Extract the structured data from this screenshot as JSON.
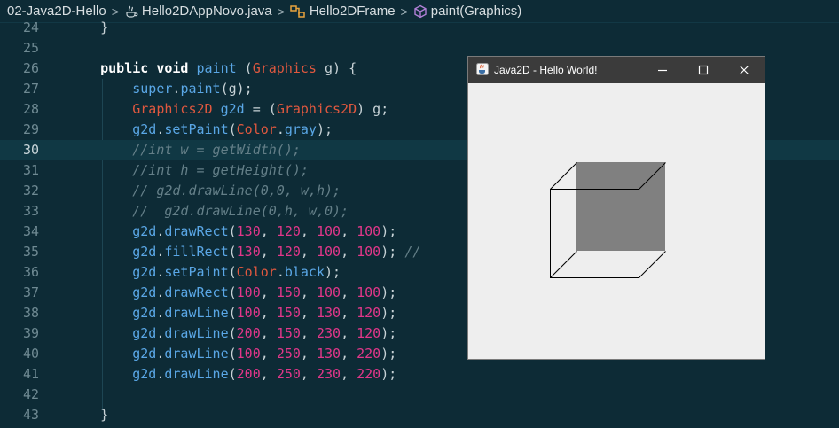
{
  "breadcrumb": {
    "items": [
      {
        "label": "02-Java2D-Hello",
        "icon": null
      },
      {
        "label": "Hello2DAppNovo.java",
        "icon": "java-file-icon"
      },
      {
        "label": "Hello2DFrame",
        "icon": "class-icon"
      },
      {
        "label": "paint(Graphics)",
        "icon": "method-cube-icon"
      }
    ],
    "separator": ">"
  },
  "editor": {
    "current_line": 30,
    "lines": [
      {
        "n": "24",
        "tokens": [
          [
            "op",
            "    }"
          ]
        ]
      },
      {
        "n": "25",
        "tokens": []
      },
      {
        "n": "26",
        "tokens": [
          [
            "op",
            "    "
          ],
          [
            "kw",
            "public"
          ],
          [
            "op",
            " "
          ],
          [
            "kw",
            "void"
          ],
          [
            "op",
            " "
          ],
          [
            "fn",
            "paint"
          ],
          [
            "op",
            " ("
          ],
          [
            "ty",
            "Graphics"
          ],
          [
            "op",
            " g) {"
          ]
        ]
      },
      {
        "n": "27",
        "tokens": [
          [
            "op",
            "        "
          ],
          [
            "id",
            "super"
          ],
          [
            "op",
            "."
          ],
          [
            "fn",
            "paint"
          ],
          [
            "op",
            "(g);"
          ]
        ]
      },
      {
        "n": "28",
        "tokens": [
          [
            "op",
            "        "
          ],
          [
            "ty",
            "Graphics2D"
          ],
          [
            "op",
            " "
          ],
          [
            "id",
            "g2d"
          ],
          [
            "op",
            " = ("
          ],
          [
            "ty",
            "Graphics2D"
          ],
          [
            "op",
            ") g;"
          ]
        ]
      },
      {
        "n": "29",
        "tokens": [
          [
            "op",
            "        "
          ],
          [
            "id",
            "g2d"
          ],
          [
            "op",
            "."
          ],
          [
            "fn",
            "setPaint"
          ],
          [
            "op",
            "("
          ],
          [
            "ty",
            "Color"
          ],
          [
            "op",
            "."
          ],
          [
            "id",
            "gray"
          ],
          [
            "op",
            ");"
          ]
        ]
      },
      {
        "n": "30",
        "tokens": [
          [
            "op",
            "        "
          ],
          [
            "cm",
            "//int w = getWidth();"
          ]
        ]
      },
      {
        "n": "31",
        "tokens": [
          [
            "op",
            "        "
          ],
          [
            "cm",
            "//int h = getHeight();"
          ]
        ]
      },
      {
        "n": "32",
        "tokens": [
          [
            "op",
            "        "
          ],
          [
            "cm",
            "// g2d.drawLine(0,0, w,h);"
          ]
        ]
      },
      {
        "n": "33",
        "tokens": [
          [
            "op",
            "        "
          ],
          [
            "cm",
            "//  g2d.drawLine(0,h, w,0);"
          ]
        ]
      },
      {
        "n": "34",
        "tokens": [
          [
            "op",
            "        "
          ],
          [
            "id",
            "g2d"
          ],
          [
            "op",
            "."
          ],
          [
            "fn",
            "drawRect"
          ],
          [
            "op",
            "("
          ],
          [
            "num",
            "130"
          ],
          [
            "op",
            ", "
          ],
          [
            "num",
            "120"
          ],
          [
            "op",
            ", "
          ],
          [
            "num",
            "100"
          ],
          [
            "op",
            ", "
          ],
          [
            "num",
            "100"
          ],
          [
            "op",
            ");"
          ]
        ]
      },
      {
        "n": "35",
        "tokens": [
          [
            "op",
            "        "
          ],
          [
            "id",
            "g2d"
          ],
          [
            "op",
            "."
          ],
          [
            "fn",
            "fillRect"
          ],
          [
            "op",
            "("
          ],
          [
            "num",
            "130"
          ],
          [
            "op",
            ", "
          ],
          [
            "num",
            "120"
          ],
          [
            "op",
            ", "
          ],
          [
            "num",
            "100"
          ],
          [
            "op",
            ", "
          ],
          [
            "num",
            "100"
          ],
          [
            "op",
            "); "
          ],
          [
            "cm",
            "//"
          ]
        ]
      },
      {
        "n": "36",
        "tokens": [
          [
            "op",
            "        "
          ],
          [
            "id",
            "g2d"
          ],
          [
            "op",
            "."
          ],
          [
            "fn",
            "setPaint"
          ],
          [
            "op",
            "("
          ],
          [
            "ty",
            "Color"
          ],
          [
            "op",
            "."
          ],
          [
            "id",
            "black"
          ],
          [
            "op",
            ");"
          ]
        ]
      },
      {
        "n": "37",
        "tokens": [
          [
            "op",
            "        "
          ],
          [
            "id",
            "g2d"
          ],
          [
            "op",
            "."
          ],
          [
            "fn",
            "drawRect"
          ],
          [
            "op",
            "("
          ],
          [
            "num",
            "100"
          ],
          [
            "op",
            ", "
          ],
          [
            "num",
            "150"
          ],
          [
            "op",
            ", "
          ],
          [
            "num",
            "100"
          ],
          [
            "op",
            ", "
          ],
          [
            "num",
            "100"
          ],
          [
            "op",
            ");"
          ]
        ]
      },
      {
        "n": "38",
        "tokens": [
          [
            "op",
            "        "
          ],
          [
            "id",
            "g2d"
          ],
          [
            "op",
            "."
          ],
          [
            "fn",
            "drawLine"
          ],
          [
            "op",
            "("
          ],
          [
            "num",
            "100"
          ],
          [
            "op",
            ", "
          ],
          [
            "num",
            "150"
          ],
          [
            "op",
            ", "
          ],
          [
            "num",
            "130"
          ],
          [
            "op",
            ", "
          ],
          [
            "num",
            "120"
          ],
          [
            "op",
            ");"
          ]
        ]
      },
      {
        "n": "39",
        "tokens": [
          [
            "op",
            "        "
          ],
          [
            "id",
            "g2d"
          ],
          [
            "op",
            "."
          ],
          [
            "fn",
            "drawLine"
          ],
          [
            "op",
            "("
          ],
          [
            "num",
            "200"
          ],
          [
            "op",
            ", "
          ],
          [
            "num",
            "150"
          ],
          [
            "op",
            ", "
          ],
          [
            "num",
            "230"
          ],
          [
            "op",
            ", "
          ],
          [
            "num",
            "120"
          ],
          [
            "op",
            ");"
          ]
        ]
      },
      {
        "n": "40",
        "tokens": [
          [
            "op",
            "        "
          ],
          [
            "id",
            "g2d"
          ],
          [
            "op",
            "."
          ],
          [
            "fn",
            "drawLine"
          ],
          [
            "op",
            "("
          ],
          [
            "num",
            "100"
          ],
          [
            "op",
            ", "
          ],
          [
            "num",
            "250"
          ],
          [
            "op",
            ", "
          ],
          [
            "num",
            "130"
          ],
          [
            "op",
            ", "
          ],
          [
            "num",
            "220"
          ],
          [
            "op",
            ");"
          ]
        ]
      },
      {
        "n": "41",
        "tokens": [
          [
            "op",
            "        "
          ],
          [
            "id",
            "g2d"
          ],
          [
            "op",
            "."
          ],
          [
            "fn",
            "drawLine"
          ],
          [
            "op",
            "("
          ],
          [
            "num",
            "200"
          ],
          [
            "op",
            ", "
          ],
          [
            "num",
            "250"
          ],
          [
            "op",
            ", "
          ],
          [
            "num",
            "230"
          ],
          [
            "op",
            ", "
          ],
          [
            "num",
            "220"
          ],
          [
            "op",
            ");"
          ]
        ]
      },
      {
        "n": "42",
        "tokens": []
      },
      {
        "n": "43",
        "tokens": [
          [
            "op",
            "    }"
          ]
        ]
      }
    ]
  },
  "window": {
    "title": "Java2D - Hello World!",
    "fill_color": "gray",
    "stroke_color": "black",
    "fill_rect": [
      130,
      120,
      100,
      100
    ],
    "front_rect": [
      100,
      150,
      100,
      100
    ],
    "edges": [
      [
        100,
        150,
        130,
        120
      ],
      [
        200,
        150,
        230,
        120
      ],
      [
        100,
        250,
        130,
        220
      ],
      [
        200,
        250,
        230,
        220
      ]
    ]
  },
  "colors": {
    "background": "#0d2b36",
    "keyword": "#ffffff",
    "method": "#5aa7e6",
    "type": "#e0583f",
    "number": "#e2378a",
    "comment": "#647f88",
    "gray": "#808080",
    "black": "#000000"
  }
}
